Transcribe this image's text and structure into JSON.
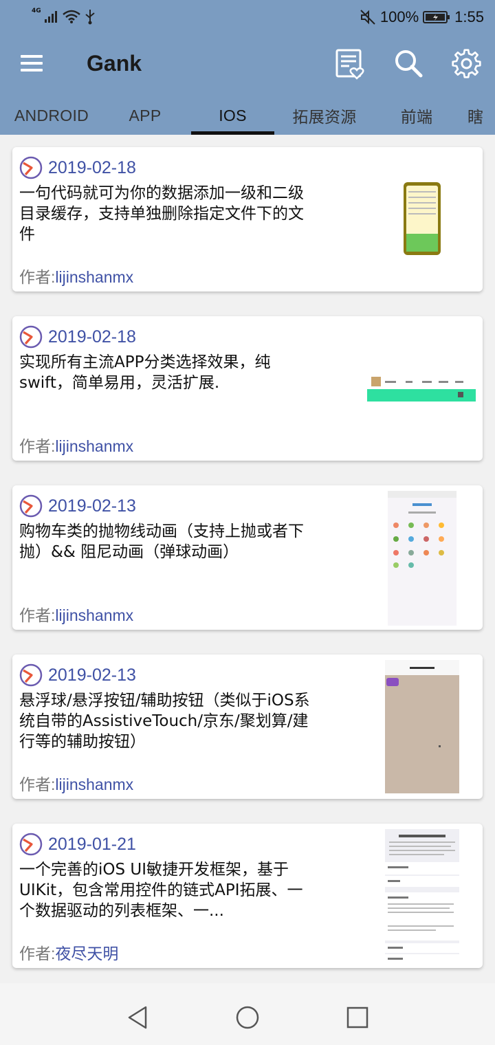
{
  "status": {
    "network": "4G",
    "battery_percent": "100%",
    "time": "1:55"
  },
  "app": {
    "title": "Gank",
    "icons": [
      "menu-icon",
      "favorites-icon",
      "search-icon",
      "settings-icon"
    ]
  },
  "tabs": [
    {
      "label": "ANDROID",
      "active": false
    },
    {
      "label": "APP",
      "active": false
    },
    {
      "label": "IOS",
      "active": true
    },
    {
      "label": "拓展资源",
      "active": false
    },
    {
      "label": "前端",
      "active": false
    },
    {
      "label": "瞎",
      "active": false
    }
  ],
  "author_prefix": "作者:",
  "cards": [
    {
      "date": "2019-02-18",
      "description": "一句代码就可为你的数据添加一级和二级目录缓存，支持单独删除指定文件下的文件",
      "author": "lijinshanmx"
    },
    {
      "date": "2019-02-18",
      "description": "实现所有主流APP分类选择效果，纯swift，简单易用，灵活扩展.",
      "author": "lijinshanmx"
    },
    {
      "date": "2019-02-13",
      "description": "购物车类的抛物线动画（支持上抛或者下抛）&& 阻尼动画（弹球动画）",
      "author": "lijinshanmx"
    },
    {
      "date": "2019-02-13",
      "description": "悬浮球/悬浮按钮/辅助按钮（类似于iOS系统自带的AssistiveTouch/京东/聚划算/建行等的辅助按钮）",
      "author": "lijinshanmx"
    },
    {
      "date": "2019-01-21",
      "description": "一个完善的iOS UI敏捷开发框架，基于UIKit，包含常用控件的链式API拓展、一个数据驱动的列表框架、一...",
      "author": "夜尽天明"
    }
  ],
  "colors": {
    "app_bar": "#7b9cc1",
    "accent": "#3f51a5",
    "background": "#f1f1f1"
  }
}
